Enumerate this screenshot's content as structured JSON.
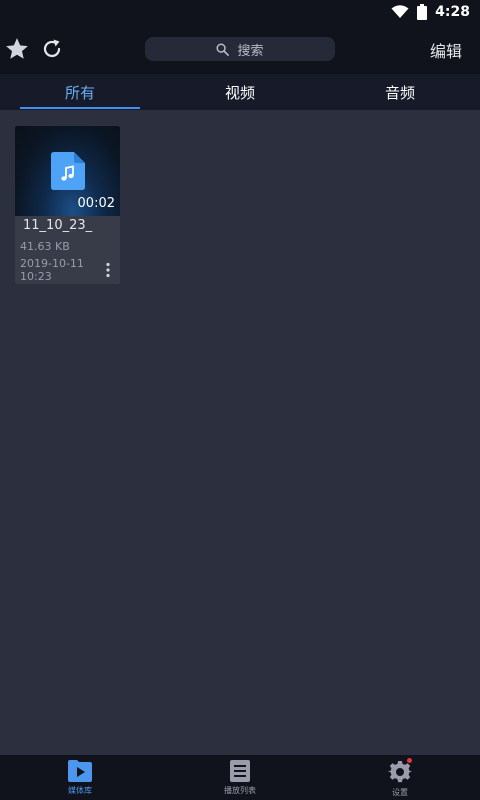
{
  "status_bar": {
    "time": "4:28",
    "icons": [
      "wifi-icon",
      "battery-icon"
    ]
  },
  "top_bar": {
    "favorite_icon": "star-icon",
    "refresh_icon": "refresh-icon",
    "search_placeholder": "搜索",
    "search_icon": "search-icon",
    "edit_label": "编辑"
  },
  "tabs": [
    {
      "label": "所有",
      "active": true
    },
    {
      "label": "视频",
      "active": false
    },
    {
      "label": "音频",
      "active": false
    }
  ],
  "media_items": [
    {
      "name": "11_10_23_",
      "duration": "00:02",
      "size": "41.63 KB",
      "date_line1": "2019-10-11",
      "date_line2": "10:23",
      "icon": "music-file-icon"
    }
  ],
  "bottom_nav": [
    {
      "label": "媒体库",
      "icon": "media-library-icon",
      "active": true
    },
    {
      "label": "播放列表",
      "icon": "playlist-icon",
      "active": false
    },
    {
      "label": "设置",
      "icon": "settings-icon",
      "active": false,
      "badge": true
    }
  ],
  "colors": {
    "accent": "#3d8ff0",
    "background": "#2c2f3e",
    "bar": "#11131c",
    "badge": "#e5363b"
  }
}
